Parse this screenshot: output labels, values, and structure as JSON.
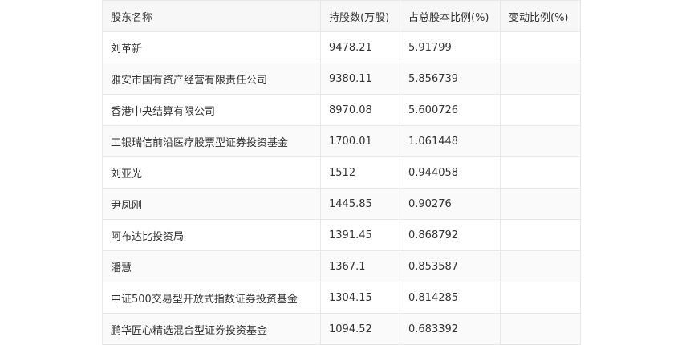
{
  "table": {
    "headers": [
      "股东名称",
      "持股数(万股)",
      "占总股本比例(%)",
      "变动比例(%)"
    ],
    "rows": [
      {
        "name": "刘革新",
        "shares": "9478.21",
        "ratio": "5.91799",
        "change": ""
      },
      {
        "name": "雅安市国有资产经营有限责任公司",
        "shares": "9380.11",
        "ratio": "5.856739",
        "change": ""
      },
      {
        "name": "香港中央结算有限公司",
        "shares": "8970.08",
        "ratio": "5.600726",
        "change": ""
      },
      {
        "name": "工银瑞信前沿医疗股票型证券投资基金",
        "shares": "1700.01",
        "ratio": "1.061448",
        "change": ""
      },
      {
        "name": "刘亚光",
        "shares": "1512",
        "ratio": "0.944058",
        "change": ""
      },
      {
        "name": "尹凤刚",
        "shares": "1445.85",
        "ratio": "0.90276",
        "change": ""
      },
      {
        "name": "阿布达比投资局",
        "shares": "1391.45",
        "ratio": "0.868792",
        "change": ""
      },
      {
        "name": "潘慧",
        "shares": "1367.1",
        "ratio": "0.853587",
        "change": ""
      },
      {
        "name": "中证500交易型开放式指数证券投资基金",
        "shares": "1304.15",
        "ratio": "0.814285",
        "change": ""
      },
      {
        "name": "鹏华匠心精选混合型证券投资基金",
        "shares": "1094.52",
        "ratio": "0.683392",
        "change": ""
      }
    ]
  }
}
